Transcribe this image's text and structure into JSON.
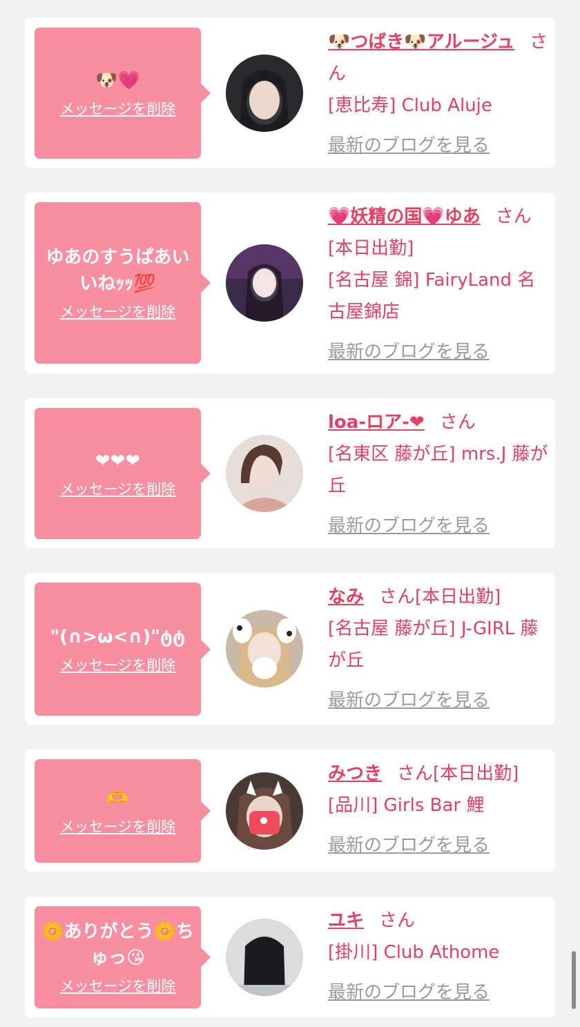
{
  "delete_label": "メッセージを削除",
  "blog_label": "最新のブログを見る",
  "honorific": "さん",
  "colors": {
    "accent": "#e83e62",
    "bubble": "#f78fa0",
    "muted": "#9a9a9a",
    "background": "#f2f2f2"
  },
  "messages": [
    {
      "message": "🐶💗",
      "cast_name": "🐶つばき🐶アルージュ",
      "badge": "",
      "shop": "[恵比寿] Club Aluje"
    },
    {
      "message": "ゆあのすうぱあいいねｯｯ💯",
      "cast_name": "💗妖精の国💗ゆあ",
      "badge": "[本日出勤]",
      "shop": "[名古屋 錦] FairyLand 名古屋錦店"
    },
    {
      "message": "❤❤❤",
      "cast_name": "loa-ロア-❤",
      "badge": "",
      "shop": "[名東区 藤が丘] mrs.J 藤が丘"
    },
    {
      "message": "\"(∩>ω<∩)\"ტტ",
      "cast_name": "なみ",
      "badge": "[本日出勤]",
      "shop": "[名古屋 藤が丘] J-GIRL 藤が丘"
    },
    {
      "message": "🫶",
      "cast_name": "みつき",
      "badge": "[本日出勤]",
      "shop": "[品川] Girls Bar 鯉"
    },
    {
      "message": "🌼ありがとう🌼ちゅっ😘",
      "cast_name": "ユキ",
      "badge": "",
      "shop": "[掛川] Club Athome"
    }
  ]
}
